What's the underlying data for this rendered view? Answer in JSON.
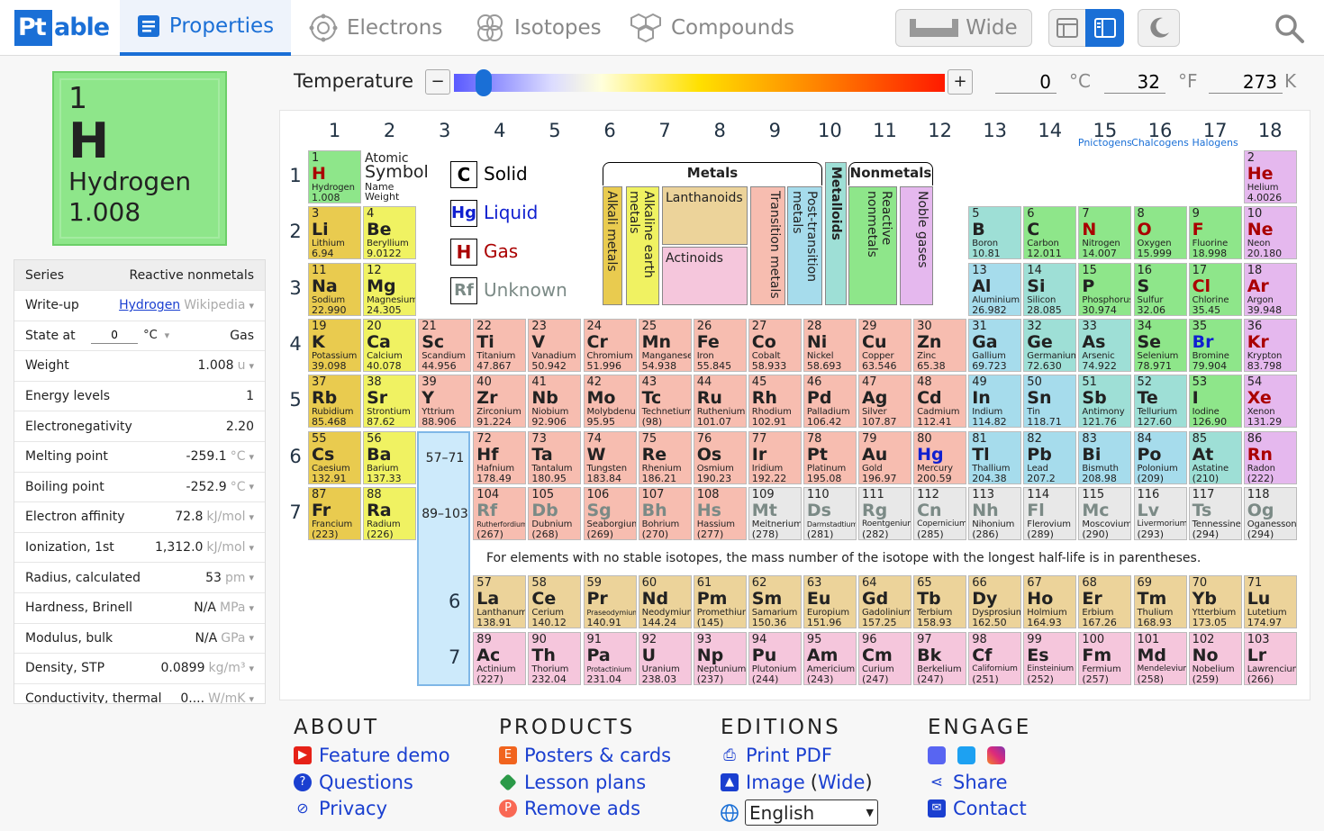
{
  "header": {
    "logo_pt": "Pt",
    "logo_rest": "able",
    "tabs": [
      {
        "label": "Properties"
      },
      {
        "label": "Electrons"
      },
      {
        "label": "Isotopes"
      },
      {
        "label": "Compounds"
      }
    ],
    "wide_label": "Wide"
  },
  "selected": {
    "number": "1",
    "symbol": "H",
    "name": "Hydrogen",
    "weight": "1.008",
    "color": "#8ee68a"
  },
  "properties": [
    {
      "key": "Series",
      "value": "Reactive nonmetals",
      "unit": ""
    },
    {
      "key": "Write-up",
      "value": "Hydrogen",
      "unit": "Wikipedia"
    },
    {
      "key": "State at",
      "value": "Gas",
      "unit": "°C"
    },
    {
      "key": "Weight",
      "value": "1.008",
      "unit": "u"
    },
    {
      "key": "Energy levels",
      "value": "1",
      "unit": ""
    },
    {
      "key": "Electronegativity",
      "value": "2.20",
      "unit": ""
    },
    {
      "key": "Melting point",
      "value": "-259.1",
      "unit": "°C"
    },
    {
      "key": "Boiling point",
      "value": "-252.9",
      "unit": "°C"
    },
    {
      "key": "Electron affinity",
      "value": "72.8",
      "unit": "kJ/mol"
    },
    {
      "key": "Ionization, 1st",
      "value": "1,312.0",
      "unit": "kJ/mol"
    },
    {
      "key": "Radius, calculated",
      "value": "53",
      "unit": "pm"
    },
    {
      "key": "Hardness, Brinell",
      "value": "N/A",
      "unit": "MPa"
    },
    {
      "key": "Modulus, bulk",
      "value": "N/A",
      "unit": "GPa"
    },
    {
      "key": "Density, STP",
      "value": "0.0899",
      "unit": "kg/m³"
    },
    {
      "key": "Conductivity, thermal",
      "value": "0....",
      "unit": "W/mK"
    }
  ],
  "state_temp": "0",
  "temperature": {
    "label": "Temperature",
    "celsius": "0",
    "fahrenheit": "32",
    "kelvin": "273",
    "c_unit": "°C",
    "f_unit": "°F",
    "k_unit": "K",
    "level": 0.06
  },
  "groups": [
    "1",
    "2",
    "3",
    "4",
    "5",
    "6",
    "7",
    "8",
    "9",
    "10",
    "11",
    "12",
    "13",
    "14",
    "15",
    "16",
    "17",
    "18"
  ],
  "group_subs": {
    "15": "Pnictogens",
    "16": "Chalcogens",
    "17": "Halogens"
  },
  "periods": [
    "1",
    "2",
    "3",
    "4",
    "5",
    "6",
    "7"
  ],
  "key": {
    "atomic": "Atomic",
    "symbol": "Symbol",
    "name": "Name",
    "weight": "Weight",
    "states": [
      {
        "sym": "C",
        "label": "Solid",
        "color": "#000"
      },
      {
        "sym": "Hg",
        "label": "Liquid",
        "color": "#1020d0"
      },
      {
        "sym": "H",
        "label": "Gas",
        "color": "#a00"
      },
      {
        "sym": "Rf",
        "label": "Unknown",
        "color": "#7b8a86"
      }
    ]
  },
  "legend": {
    "metals": "Metals",
    "nonmetals": "Nonmetals",
    "alkali": "Alkali metals",
    "alkaline": "Alkaline earth metals",
    "lanthanoids": "Lanthanoids",
    "actinoids": "Actinoids",
    "transition": "Transition metals",
    "post": "Post-transition metals",
    "metalloids": "Metalloids",
    "reactive": "Reactive nonmetals",
    "noble": "Noble gases"
  },
  "fblock": {
    "la_range": "57–71",
    "ac_range": "89–103",
    "la_period": "6",
    "ac_period": "7"
  },
  "note": "For elements with no stable isotopes, the mass number of the isotope with the longest half-life is in parentheses.",
  "elements": [
    [
      "1",
      "H",
      "Hydrogen",
      "1.008",
      1,
      1,
      "rn",
      "g"
    ],
    [
      "2",
      "He",
      "Helium",
      "4.0026",
      1,
      18,
      "ng",
      "g"
    ],
    [
      "3",
      "Li",
      "Lithium",
      "6.94",
      2,
      1,
      "alk",
      "s"
    ],
    [
      "4",
      "Be",
      "Beryllium",
      "9.0122",
      2,
      2,
      "ae",
      "s"
    ],
    [
      "5",
      "B",
      "Boron",
      "10.81",
      2,
      13,
      "md",
      "s"
    ],
    [
      "6",
      "C",
      "Carbon",
      "12.011",
      2,
      14,
      "rn",
      "s"
    ],
    [
      "7",
      "N",
      "Nitrogen",
      "14.007",
      2,
      15,
      "rn",
      "g"
    ],
    [
      "8",
      "O",
      "Oxygen",
      "15.999",
      2,
      16,
      "rn",
      "g"
    ],
    [
      "9",
      "F",
      "Fluorine",
      "18.998",
      2,
      17,
      "rn",
      "g"
    ],
    [
      "10",
      "Ne",
      "Neon",
      "20.180",
      2,
      18,
      "ng",
      "g"
    ],
    [
      "11",
      "Na",
      "Sodium",
      "22.990",
      3,
      1,
      "alk",
      "s"
    ],
    [
      "12",
      "Mg",
      "Magnesium",
      "24.305",
      3,
      2,
      "ae",
      "s"
    ],
    [
      "13",
      "Al",
      "Aluminium",
      "26.982",
      3,
      13,
      "pt",
      "s"
    ],
    [
      "14",
      "Si",
      "Silicon",
      "28.085",
      3,
      14,
      "md",
      "s"
    ],
    [
      "15",
      "P",
      "Phosphorus",
      "30.974",
      3,
      15,
      "rn",
      "s"
    ],
    [
      "16",
      "S",
      "Sulfur",
      "32.06",
      3,
      16,
      "rn",
      "s"
    ],
    [
      "17",
      "Cl",
      "Chlorine",
      "35.45",
      3,
      17,
      "rn",
      "g"
    ],
    [
      "18",
      "Ar",
      "Argon",
      "39.948",
      3,
      18,
      "ng",
      "g"
    ],
    [
      "19",
      "K",
      "Potassium",
      "39.098",
      4,
      1,
      "alk",
      "s"
    ],
    [
      "20",
      "Ca",
      "Calcium",
      "40.078",
      4,
      2,
      "ae",
      "s"
    ],
    [
      "21",
      "Sc",
      "Scandium",
      "44.956",
      4,
      3,
      "tm",
      "s"
    ],
    [
      "22",
      "Ti",
      "Titanium",
      "47.867",
      4,
      4,
      "tm",
      "s"
    ],
    [
      "23",
      "V",
      "Vanadium",
      "50.942",
      4,
      5,
      "tm",
      "s"
    ],
    [
      "24",
      "Cr",
      "Chromium",
      "51.996",
      4,
      6,
      "tm",
      "s"
    ],
    [
      "25",
      "Mn",
      "Manganese",
      "54.938",
      4,
      7,
      "tm",
      "s"
    ],
    [
      "26",
      "Fe",
      "Iron",
      "55.845",
      4,
      8,
      "tm",
      "s"
    ],
    [
      "27",
      "Co",
      "Cobalt",
      "58.933",
      4,
      9,
      "tm",
      "s"
    ],
    [
      "28",
      "Ni",
      "Nickel",
      "58.693",
      4,
      10,
      "tm",
      "s"
    ],
    [
      "29",
      "Cu",
      "Copper",
      "63.546",
      4,
      11,
      "tm",
      "s"
    ],
    [
      "30",
      "Zn",
      "Zinc",
      "65.38",
      4,
      12,
      "tm",
      "s"
    ],
    [
      "31",
      "Ga",
      "Gallium",
      "69.723",
      4,
      13,
      "pt",
      "s"
    ],
    [
      "32",
      "Ge",
      "Germanium",
      "72.630",
      4,
      14,
      "md",
      "s"
    ],
    [
      "33",
      "As",
      "Arsenic",
      "74.922",
      4,
      15,
      "md",
      "s"
    ],
    [
      "34",
      "Se",
      "Selenium",
      "78.971",
      4,
      16,
      "rn",
      "s"
    ],
    [
      "35",
      "Br",
      "Bromine",
      "79.904",
      4,
      17,
      "rn",
      "l"
    ],
    [
      "36",
      "Kr",
      "Krypton",
      "83.798",
      4,
      18,
      "ng",
      "g"
    ],
    [
      "37",
      "Rb",
      "Rubidium",
      "85.468",
      5,
      1,
      "alk",
      "s"
    ],
    [
      "38",
      "Sr",
      "Strontium",
      "87.62",
      5,
      2,
      "ae",
      "s"
    ],
    [
      "39",
      "Y",
      "Yttrium",
      "88.906",
      5,
      3,
      "tm",
      "s"
    ],
    [
      "40",
      "Zr",
      "Zirconium",
      "91.224",
      5,
      4,
      "tm",
      "s"
    ],
    [
      "41",
      "Nb",
      "Niobium",
      "92.906",
      5,
      5,
      "tm",
      "s"
    ],
    [
      "42",
      "Mo",
      "Molybdenum",
      "95.95",
      5,
      6,
      "tm",
      "s"
    ],
    [
      "43",
      "Tc",
      "Technetium",
      "(98)",
      5,
      7,
      "tm",
      "s"
    ],
    [
      "44",
      "Ru",
      "Ruthenium",
      "101.07",
      5,
      8,
      "tm",
      "s"
    ],
    [
      "45",
      "Rh",
      "Rhodium",
      "102.91",
      5,
      9,
      "tm",
      "s"
    ],
    [
      "46",
      "Pd",
      "Palladium",
      "106.42",
      5,
      10,
      "tm",
      "s"
    ],
    [
      "47",
      "Ag",
      "Silver",
      "107.87",
      5,
      11,
      "tm",
      "s"
    ],
    [
      "48",
      "Cd",
      "Cadmium",
      "112.41",
      5,
      12,
      "tm",
      "s"
    ],
    [
      "49",
      "In",
      "Indium",
      "114.82",
      5,
      13,
      "pt",
      "s"
    ],
    [
      "50",
      "Sn",
      "Tin",
      "118.71",
      5,
      14,
      "pt",
      "s"
    ],
    [
      "51",
      "Sb",
      "Antimony",
      "121.76",
      5,
      15,
      "md",
      "s"
    ],
    [
      "52",
      "Te",
      "Tellurium",
      "127.60",
      5,
      16,
      "md",
      "s"
    ],
    [
      "53",
      "I",
      "Iodine",
      "126.90",
      5,
      17,
      "rn",
      "s"
    ],
    [
      "54",
      "Xe",
      "Xenon",
      "131.29",
      5,
      18,
      "ng",
      "g"
    ],
    [
      "55",
      "Cs",
      "Caesium",
      "132.91",
      6,
      1,
      "alk",
      "s"
    ],
    [
      "56",
      "Ba",
      "Barium",
      "137.33",
      6,
      2,
      "ae",
      "s"
    ],
    [
      "72",
      "Hf",
      "Hafnium",
      "178.49",
      6,
      4,
      "tm",
      "s"
    ],
    [
      "73",
      "Ta",
      "Tantalum",
      "180.95",
      6,
      5,
      "tm",
      "s"
    ],
    [
      "74",
      "W",
      "Tungsten",
      "183.84",
      6,
      6,
      "tm",
      "s"
    ],
    [
      "75",
      "Re",
      "Rhenium",
      "186.21",
      6,
      7,
      "tm",
      "s"
    ],
    [
      "76",
      "Os",
      "Osmium",
      "190.23",
      6,
      8,
      "tm",
      "s"
    ],
    [
      "77",
      "Ir",
      "Iridium",
      "192.22",
      6,
      9,
      "tm",
      "s"
    ],
    [
      "78",
      "Pt",
      "Platinum",
      "195.08",
      6,
      10,
      "tm",
      "s"
    ],
    [
      "79",
      "Au",
      "Gold",
      "196.97",
      6,
      11,
      "tm",
      "s"
    ],
    [
      "80",
      "Hg",
      "Mercury",
      "200.59",
      6,
      12,
      "tm",
      "l"
    ],
    [
      "81",
      "Tl",
      "Thallium",
      "204.38",
      6,
      13,
      "pt",
      "s"
    ],
    [
      "82",
      "Pb",
      "Lead",
      "207.2",
      6,
      14,
      "pt",
      "s"
    ],
    [
      "83",
      "Bi",
      "Bismuth",
      "208.98",
      6,
      15,
      "pt",
      "s"
    ],
    [
      "84",
      "Po",
      "Polonium",
      "(209)",
      6,
      16,
      "pt",
      "s"
    ],
    [
      "85",
      "At",
      "Astatine",
      "(210)",
      6,
      17,
      "md",
      "s"
    ],
    [
      "86",
      "Rn",
      "Radon",
      "(222)",
      6,
      18,
      "ng",
      "g"
    ],
    [
      "87",
      "Fr",
      "Francium",
      "(223)",
      7,
      1,
      "alk",
      "s"
    ],
    [
      "88",
      "Ra",
      "Radium",
      "(226)",
      7,
      2,
      "ae",
      "s"
    ],
    [
      "104",
      "Rf",
      "Rutherfordium",
      "(267)",
      7,
      4,
      "tm",
      "u"
    ],
    [
      "105",
      "Db",
      "Dubnium",
      "(268)",
      7,
      5,
      "tm",
      "u"
    ],
    [
      "106",
      "Sg",
      "Seaborgium",
      "(269)",
      7,
      6,
      "tm",
      "u"
    ],
    [
      "107",
      "Bh",
      "Bohrium",
      "(270)",
      7,
      7,
      "tm",
      "u"
    ],
    [
      "108",
      "Hs",
      "Hassium",
      "(277)",
      7,
      8,
      "tm",
      "u"
    ],
    [
      "109",
      "Mt",
      "Meitnerium",
      "(278)",
      7,
      9,
      "un",
      "u"
    ],
    [
      "110",
      "Ds",
      "Darmstadtium",
      "(281)",
      7,
      10,
      "un",
      "u"
    ],
    [
      "111",
      "Rg",
      "Roentgenium",
      "(282)",
      7,
      11,
      "un",
      "u"
    ],
    [
      "112",
      "Cn",
      "Copernicium",
      "(285)",
      7,
      12,
      "un",
      "u"
    ],
    [
      "113",
      "Nh",
      "Nihonium",
      "(286)",
      7,
      13,
      "un",
      "u"
    ],
    [
      "114",
      "Fl",
      "Flerovium",
      "(289)",
      7,
      14,
      "un",
      "u"
    ],
    [
      "115",
      "Mc",
      "Moscovium",
      "(290)",
      7,
      15,
      "un",
      "u"
    ],
    [
      "116",
      "Lv",
      "Livermorium",
      "(293)",
      7,
      16,
      "un",
      "u"
    ],
    [
      "117",
      "Ts",
      "Tennessine",
      "(294)",
      7,
      17,
      "un",
      "u"
    ],
    [
      "118",
      "Og",
      "Oganesson",
      "(294)",
      7,
      18,
      "un",
      "u"
    ],
    [
      "57",
      "La",
      "Lanthanum",
      "138.91",
      9,
      4,
      "la",
      "s"
    ],
    [
      "58",
      "Ce",
      "Cerium",
      "140.12",
      9,
      5,
      "la",
      "s"
    ],
    [
      "59",
      "Pr",
      "Praseodymium",
      "140.91",
      9,
      6,
      "la",
      "s"
    ],
    [
      "60",
      "Nd",
      "Neodymium",
      "144.24",
      9,
      7,
      "la",
      "s"
    ],
    [
      "61",
      "Pm",
      "Promethium",
      "(145)",
      9,
      8,
      "la",
      "s"
    ],
    [
      "62",
      "Sm",
      "Samarium",
      "150.36",
      9,
      9,
      "la",
      "s"
    ],
    [
      "63",
      "Eu",
      "Europium",
      "151.96",
      9,
      10,
      "la",
      "s"
    ],
    [
      "64",
      "Gd",
      "Gadolinium",
      "157.25",
      9,
      11,
      "la",
      "s"
    ],
    [
      "65",
      "Tb",
      "Terbium",
      "158.93",
      9,
      12,
      "la",
      "s"
    ],
    [
      "66",
      "Dy",
      "Dysprosium",
      "162.50",
      9,
      13,
      "la",
      "s"
    ],
    [
      "67",
      "Ho",
      "Holmium",
      "164.93",
      9,
      14,
      "la",
      "s"
    ],
    [
      "68",
      "Er",
      "Erbium",
      "167.26",
      9,
      15,
      "la",
      "s"
    ],
    [
      "69",
      "Tm",
      "Thulium",
      "168.93",
      9,
      16,
      "la",
      "s"
    ],
    [
      "70",
      "Yb",
      "Ytterbium",
      "173.05",
      9,
      17,
      "la",
      "s"
    ],
    [
      "71",
      "Lu",
      "Lutetium",
      "174.97",
      9,
      18,
      "la",
      "s"
    ],
    [
      "89",
      "Ac",
      "Actinium",
      "(227)",
      10,
      4,
      "ac",
      "s"
    ],
    [
      "90",
      "Th",
      "Thorium",
      "232.04",
      10,
      5,
      "ac",
      "s"
    ],
    [
      "91",
      "Pa",
      "Protactinium",
      "231.04",
      10,
      6,
      "ac",
      "s"
    ],
    [
      "92",
      "U",
      "Uranium",
      "238.03",
      10,
      7,
      "ac",
      "s"
    ],
    [
      "93",
      "Np",
      "Neptunium",
      "(237)",
      10,
      8,
      "ac",
      "s"
    ],
    [
      "94",
      "Pu",
      "Plutonium",
      "(244)",
      10,
      9,
      "ac",
      "s"
    ],
    [
      "95",
      "Am",
      "Americium",
      "(243)",
      10,
      10,
      "ac",
      "s"
    ],
    [
      "96",
      "Cm",
      "Curium",
      "(247)",
      10,
      11,
      "ac",
      "s"
    ],
    [
      "97",
      "Bk",
      "Berkelium",
      "(247)",
      10,
      12,
      "ac",
      "s"
    ],
    [
      "98",
      "Cf",
      "Californium",
      "(251)",
      10,
      13,
      "ac",
      "s"
    ],
    [
      "99",
      "Es",
      "Einsteinium",
      "(252)",
      10,
      14,
      "ac",
      "s"
    ],
    [
      "100",
      "Fm",
      "Fermium",
      "(257)",
      10,
      15,
      "ac",
      "s"
    ],
    [
      "101",
      "Md",
      "Mendelevium",
      "(258)",
      10,
      16,
      "ac",
      "s"
    ],
    [
      "102",
      "No",
      "Nobelium",
      "(259)",
      10,
      17,
      "ac",
      "s"
    ],
    [
      "103",
      "Lr",
      "Lawrencium",
      "(266)",
      10,
      18,
      "ac",
      "s"
    ]
  ],
  "footer": {
    "about": "ABOUT",
    "products": "PRODUCTS",
    "editions": "EDITIONS",
    "engage": "ENGAGE",
    "feature_demo": "Feature demo",
    "questions": "Questions",
    "privacy": "Privacy",
    "posters": "Posters & cards",
    "lessons": "Lesson plans",
    "remove_ads": "Remove ads",
    "print_pdf": "Print PDF",
    "image": "Image",
    "image_wide": "Wide",
    "share": "Share",
    "contact": "Contact",
    "language": "English"
  }
}
